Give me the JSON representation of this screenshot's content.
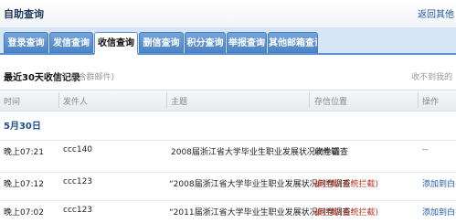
{
  "header": {
    "title": "自助查询",
    "top_link": "返回其他"
  },
  "tabs": [
    {
      "label": "登录查询",
      "active": false
    },
    {
      "label": "发信查询",
      "active": false
    },
    {
      "label": "收信查询",
      "active": true
    },
    {
      "label": "删信查询",
      "active": false
    },
    {
      "label": "积分查询",
      "active": false
    },
    {
      "label": "举报查询",
      "active": false
    },
    {
      "label": "其他邮箱查询",
      "active": false
    }
  ],
  "section": {
    "title": "最近30天收信记录",
    "subtitle": "(不包含群邮件)",
    "right_text": "收不到我的"
  },
  "columns": {
    "time": "时间",
    "sender": "发件人",
    "subject": "主题",
    "location": "存信位置",
    "action": "操作"
  },
  "date_group": "5月30日",
  "rows": [
    {
      "time": "晚上07:21",
      "sender": "ccc140",
      "subject": "2008届浙江省大学毕业生职业发展状况问卷调查",
      "location": "收件箱",
      "action": "--"
    },
    {
      "time": "晚上07:12",
      "sender": "ccc123",
      "subject": "“2008届浙江省大学毕业生职业发展状况问卷调查”",
      "location": "被拦截(系统拦截)",
      "action": "添加到白名单"
    },
    {
      "time": "晚上07:02",
      "sender": "ccc123",
      "subject": "“2011届浙江省大学毕业生职业发展状况问卷调查”",
      "location": "被拦截(系统拦截)",
      "action": "添加到白名单"
    }
  ]
}
